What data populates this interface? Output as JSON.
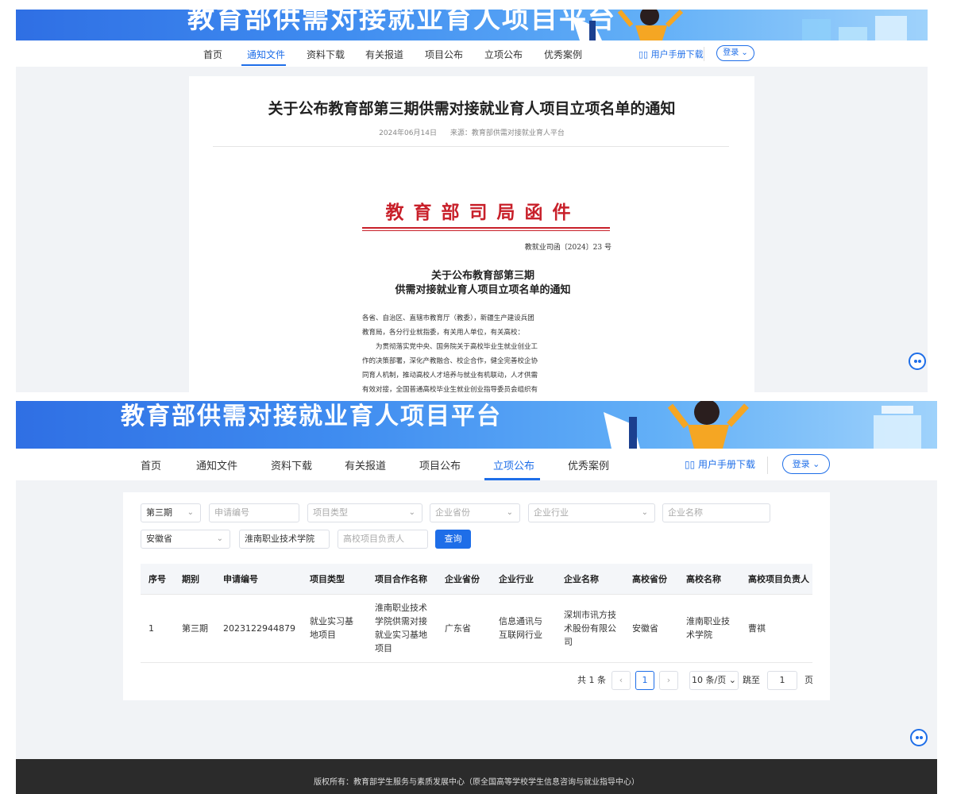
{
  "colors": {
    "accent": "#1e6ee8",
    "red_header": "#c8202a",
    "footer_bg": "#2b2b2b"
  },
  "site_title": "教育部供需对接就业育人项目平台",
  "nav": [
    "首页",
    "通知文件",
    "资料下载",
    "有关报道",
    "项目公布",
    "立项公布",
    "优秀案例"
  ],
  "manual_label": "用户手册下载",
  "login_label": "登录",
  "top": {
    "active_tab": "通知文件",
    "article": {
      "title": "关于公布教育部第三期供需对接就业育人项目立项名单的通知",
      "date": "2024年06月14日",
      "source": "来源：教育部供需对接就业育人平台"
    },
    "document": {
      "header": "教育部司局函件",
      "number": "教就业司函〔2024〕23 号",
      "title_line1": "关于公布教育部第三期",
      "title_line2": "供需对接就业育人项目立项名单的通知",
      "body": [
        "各省、自治区、直辖市教育厅（教委），新疆生产建设兵团",
        "教育局，各分行业就指委，有关用人单位，有关高校：",
        "　　为贯彻落实党中央、国务院关于高校毕业生就业创业工",
        "作的决策部署，深化产教融合、校企合作，健全完善校企协",
        "同育人机制，推动高校人才培养与就业有机联动，人才供需",
        "有效对接，全国普通高校毕业生就业创业指导委员会组织有"
      ]
    }
  },
  "bottom": {
    "active_tab": "立项公布",
    "filters": {
      "period": "第三期",
      "app_no_placeholder": "申请编号",
      "project_type_placeholder": "项目类型",
      "company_province_placeholder": "企业省份",
      "company_industry_placeholder": "企业行业",
      "company_name_placeholder": "企业名称",
      "school_province": "安徽省",
      "school_name": "淮南职业技术学院",
      "leader_placeholder": "高校项目负责人",
      "query_label": "查询"
    },
    "table": {
      "headers": [
        "序号",
        "期别",
        "申请编号",
        "项目类型",
        "项目合作名称",
        "企业省份",
        "企业行业",
        "企业名称",
        "高校省份",
        "高校名称",
        "高校项目负责人"
      ],
      "rows": [
        [
          "1",
          "第三期",
          "2023122944879",
          "就业实习基地项目",
          "淮南职业技术学院供需对接就业实习基地项目",
          "广东省",
          "信息通讯与互联网行业",
          "深圳市讯方技术股份有限公司",
          "安徽省",
          "淮南职业技术学院",
          "曹祺"
        ]
      ]
    },
    "pagination": {
      "total_text": "共 1 条",
      "current_page": "1",
      "page_size": "10 条/页",
      "jump_label": "跳至",
      "jump_value": "1",
      "page_suffix": "页"
    },
    "footer": "版权所有：教育部学生服务与素质发展中心（原全国高等学校学生信息咨询与就业指导中心）"
  }
}
